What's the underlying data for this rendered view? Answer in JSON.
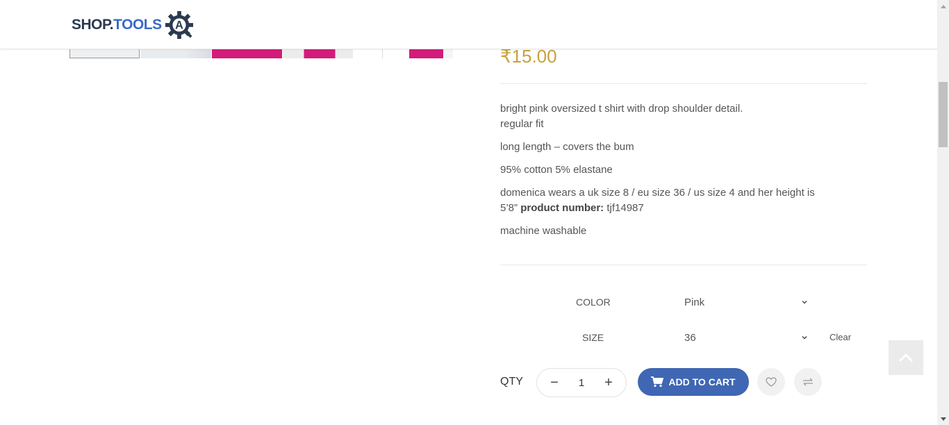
{
  "header": {
    "logo_shop": "SHOP.",
    "logo_tools": "TOOLS",
    "logo_letter": "A"
  },
  "product": {
    "price": "₹15.00",
    "description": {
      "line1": "bright pink oversized t shirt with drop shoulder detail.",
      "line2": "regular fit",
      "line3": "long length – covers the bum",
      "line4": "95% cotton 5% elastane",
      "line5": "domenica wears a uk size 8 / eu size 36 / us size 4 and her height is 5’8”",
      "product_number_label": "product number:",
      "product_number": "tjf14987",
      "line6": "machine washable"
    }
  },
  "variations": {
    "color_label": "COLOR",
    "color_value": "Pink",
    "size_label": "SIZE",
    "size_value": "36",
    "clear_label": "Clear"
  },
  "cart": {
    "qty_label": "QTY",
    "minus": "−",
    "plus": "+",
    "qty_value": "1",
    "add_to_cart_label": "ADD TO CART"
  },
  "icons": {
    "cart": "cart-icon",
    "wishlist": "heart-icon",
    "compare": "compare-arrows-icon",
    "back_to_top": "chevron-up-icon"
  },
  "colors": {
    "accent": "#3f67b3",
    "price": "#c9a13c",
    "thumb_pink": "#d31b7a"
  }
}
